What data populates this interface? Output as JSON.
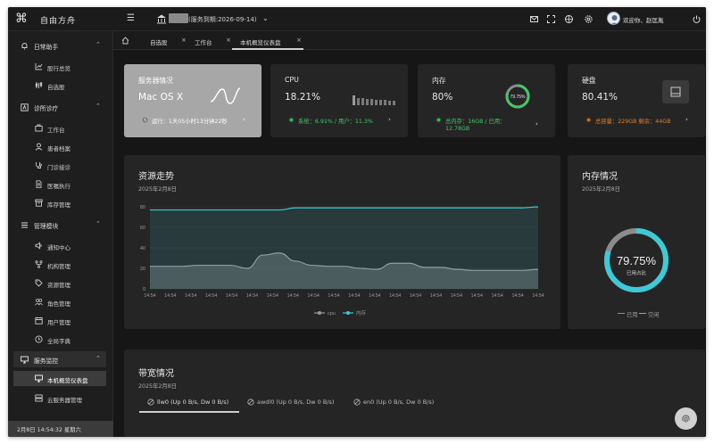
{
  "app": {
    "name": "自由方舟",
    "service_text": "(服务到期:2026-09-14)"
  },
  "header": {
    "welcome": "欢迎你、赵匡胤"
  },
  "sidebar": {
    "groups": [
      {
        "label": "日常助手",
        "items": [
          {
            "label": "股行总览"
          },
          {
            "label": "自选股"
          }
        ]
      },
      {
        "label": "诊所诊疗",
        "items": [
          {
            "label": "工作台"
          },
          {
            "label": "患者档案"
          },
          {
            "label": "门诊接诊"
          },
          {
            "label": "医嘱执行"
          },
          {
            "label": "库存管理"
          }
        ]
      },
      {
        "label": "管理模块",
        "items": [
          {
            "label": "通知中心"
          },
          {
            "label": "机构管理"
          },
          {
            "label": "资源管理"
          },
          {
            "label": "角色管理"
          },
          {
            "label": "用户管理"
          },
          {
            "label": "全局字典"
          }
        ]
      },
      {
        "label": "服务监控",
        "items": [
          {
            "label": "本机概览仪表盘"
          },
          {
            "label": "云服务器管理"
          }
        ]
      }
    ],
    "footer": "2月8日  14:54:32  星期六"
  },
  "tabs": [
    {
      "label": "自选股"
    },
    {
      "label": "工作台"
    },
    {
      "label": "本机概览仪表盘"
    }
  ],
  "cards": {
    "server": {
      "title": "服务器情况",
      "os": "Mac OS X",
      "uptime": "运行：1天05小时13分钟22秒"
    },
    "cpu": {
      "title": "CPU",
      "value": "18.21%",
      "sub": "系统：6.91% / 用户：11.3%"
    },
    "memory": {
      "title": "内存",
      "value": "80%",
      "sub_line1": "总内存：16GB / 已用：",
      "sub_line2": "12.78GB",
      "ring_label": "79.75%",
      "ring_fraction": 0.7975
    },
    "disk": {
      "title": "硬盘",
      "value": "80.41%",
      "sub": "总容量：229GB  剩余：44GB"
    }
  },
  "resource": {
    "title": "资源走势",
    "date": "2025年2月8日"
  },
  "memory_panel": {
    "title": "内存情况",
    "date": "2025年2月8日",
    "value": "79.75%",
    "caption": "已用占比",
    "legend_used": "已用",
    "legend_free": "空闲",
    "fraction": 0.7975
  },
  "bandwidth": {
    "title": "带宽情况",
    "date": "2025年2月8日",
    "tabs": [
      {
        "label": "llw0 (Up 0 B/s, Dw 0 B/s)"
      },
      {
        "label": "awdl0 (Up 0 B/s, Dw 0 B/s)"
      },
      {
        "label": "en0 (Up 0 B/s, Dw 0 B/s)"
      }
    ]
  },
  "colors": {
    "teal": "#3ec9d6",
    "gray_line": "#9a9a9a",
    "green": "#44c767",
    "orange": "#e0802c",
    "ring_bg": "#8c8c8c"
  },
  "chart_data": {
    "type": "area",
    "ylim": [
      0,
      80
    ],
    "yticks": [
      0,
      20,
      40,
      60,
      80
    ],
    "x_tick_labels": [
      "14:54",
      "14:54",
      "14:54",
      "14:54",
      "14:54",
      "14:54",
      "14:54",
      "14:54",
      "14:54",
      "14:54",
      "14:54",
      "14:54",
      "14:54",
      "14:54",
      "14:54",
      "14:54",
      "14:54",
      "14:54",
      "14:54",
      "14:54"
    ],
    "series": [
      {
        "name": "cpu",
        "color": "#9a9a9a",
        "values": [
          22,
          22,
          22,
          23,
          23,
          23,
          20,
          33,
          35,
          27,
          23,
          22,
          22,
          20,
          19,
          25,
          25,
          21,
          21,
          19,
          18,
          18,
          18,
          18,
          19
        ]
      },
      {
        "name": "内存",
        "color": "#3ec9d6",
        "values": [
          77,
          77,
          77,
          77,
          77,
          77,
          77,
          77,
          77,
          79,
          79,
          79,
          79,
          79,
          79,
          79,
          79,
          79,
          79,
          79,
          79,
          79,
          79,
          79,
          80
        ]
      }
    ],
    "grid": true,
    "legend": "bottom"
  }
}
